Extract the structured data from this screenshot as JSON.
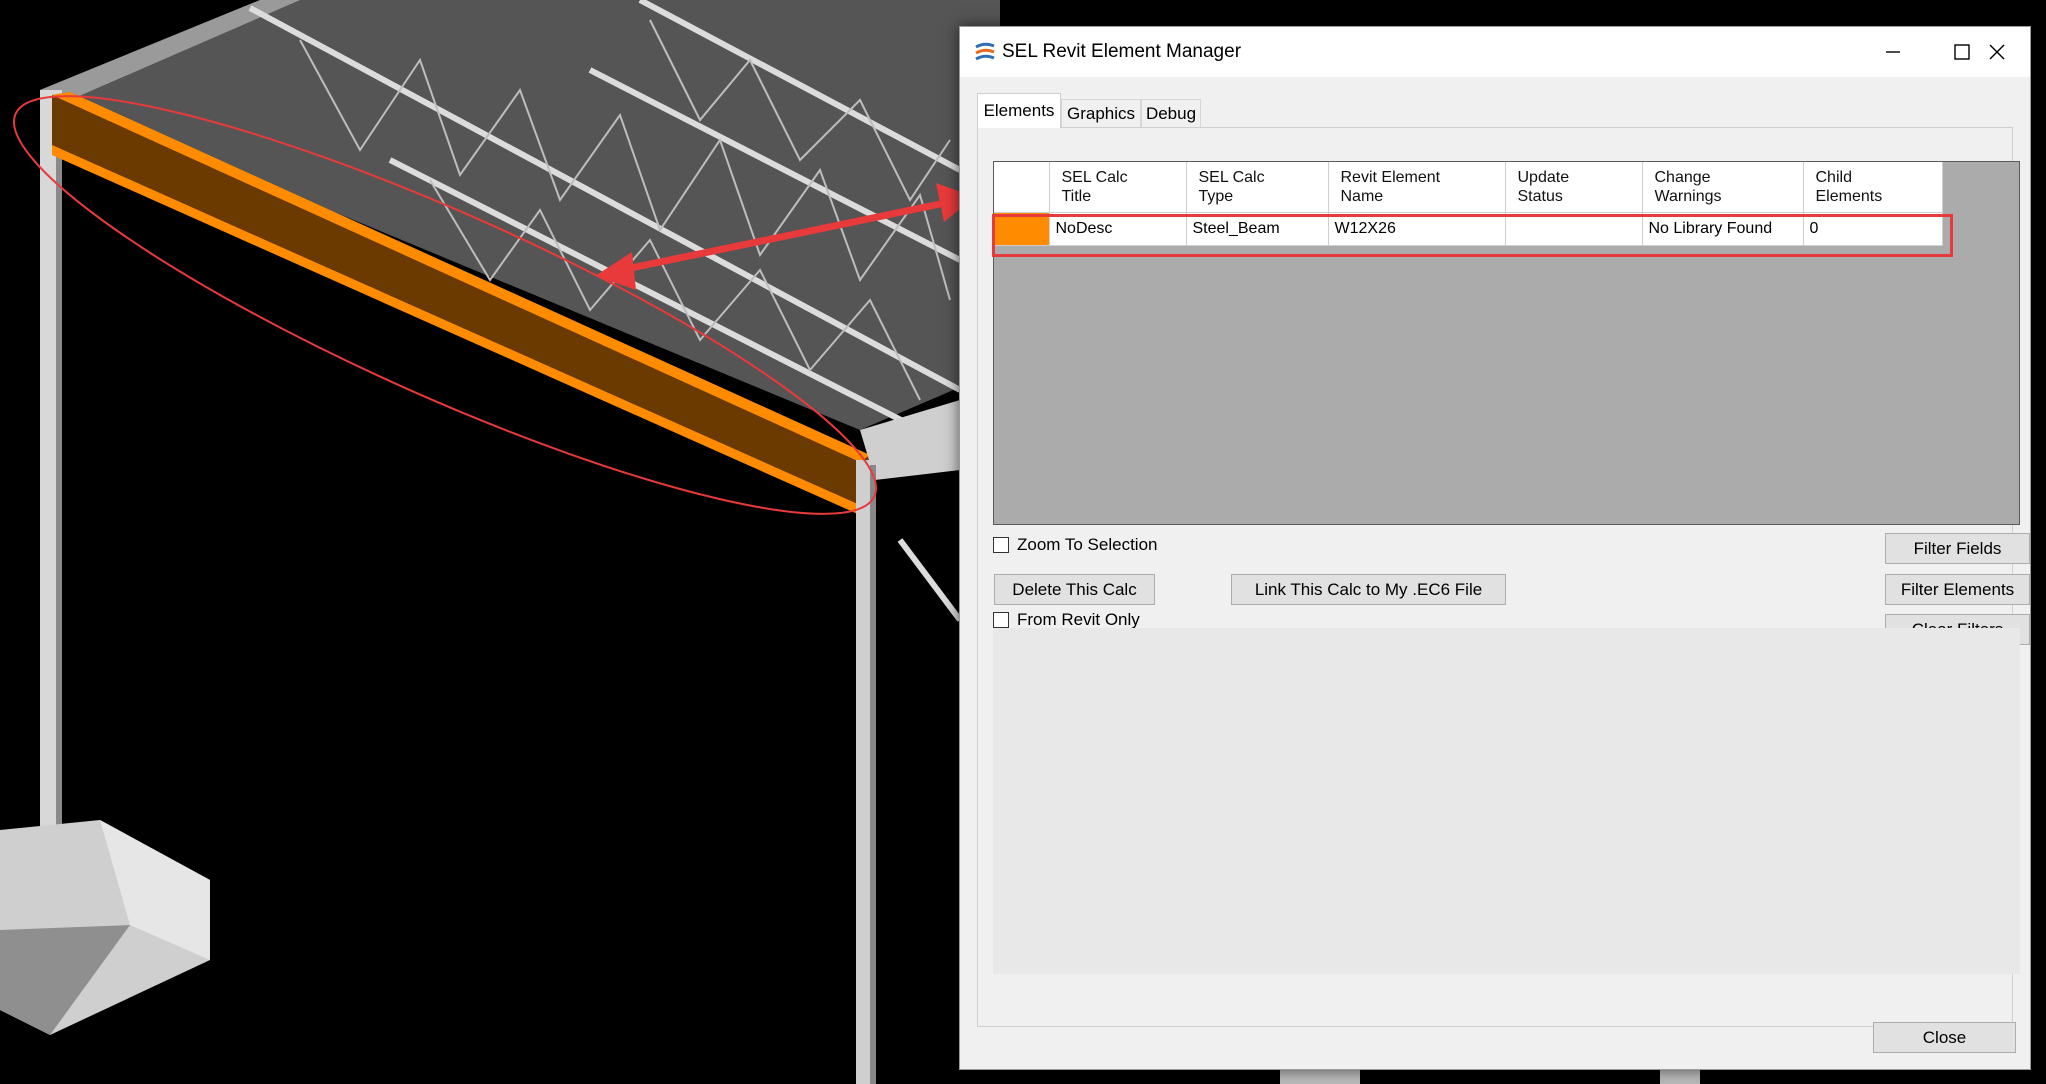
{
  "window": {
    "title": "SEL Revit Element Manager",
    "accent_color": "#ff8c00",
    "highlight_color": "#e83a3a"
  },
  "tabs": [
    {
      "label": "Elements",
      "active": true
    },
    {
      "label": "Graphics",
      "active": false
    },
    {
      "label": "Debug",
      "active": false
    }
  ],
  "grid": {
    "columns": [
      "SEL Calc\nTitle",
      "SEL Calc\nType",
      "Revit Element\nName",
      "Update\nStatus",
      "Change\nWarnings",
      "Child\nElements"
    ],
    "rows": [
      {
        "title": "NoDesc",
        "type": "Steel_Beam",
        "name": "W12X26",
        "status": "",
        "warnings": "No Library Found",
        "children": "0"
      }
    ]
  },
  "controls": {
    "zoom_to_selection": "Zoom To Selection",
    "from_revit_only": "From Revit Only",
    "delete_calc": "Delete This Calc",
    "link_calc": "Link This Calc to My .EC6 File",
    "filter_fields": "Filter Fields",
    "filter_elements": "Filter Elements",
    "clear_filters": "Clear Filters",
    "close": "Close"
  },
  "icons": [
    "app-logo-icon",
    "minimize-icon",
    "maximize-icon",
    "close-icon"
  ]
}
